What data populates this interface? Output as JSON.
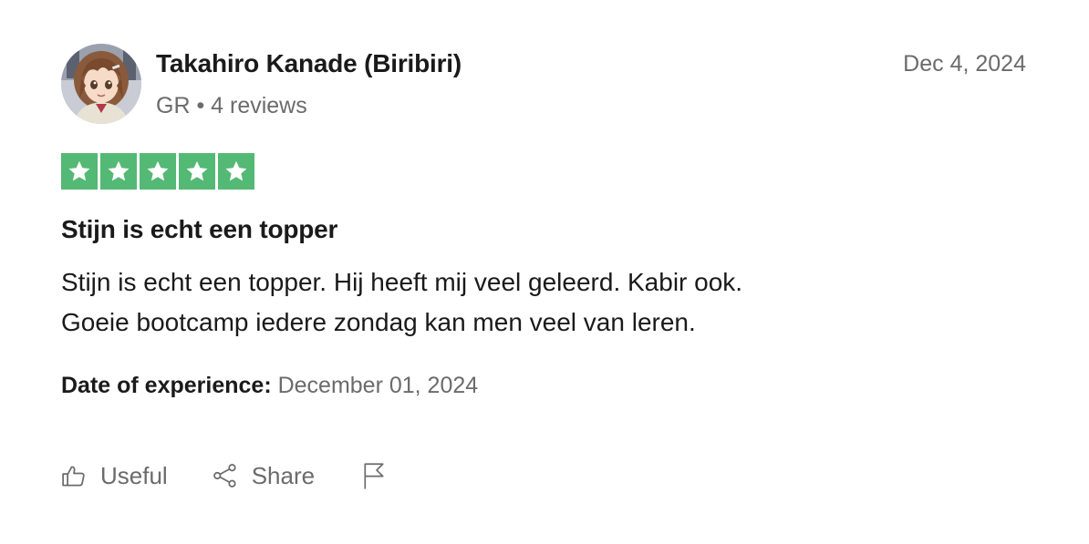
{
  "reviewer": {
    "name": "Takahiro Kanade (Biribiri)",
    "meta": "GR • 4 reviews",
    "avatar_icon": "anime-girl-avatar"
  },
  "review": {
    "date": "Dec 4, 2024",
    "rating": 5,
    "rating_max": 5,
    "star_color": "#54b974",
    "title": "Stijn is echt een topper",
    "body_lines": [
      "Stijn is echt een topper. Hij heeft mij veel geleerd. Kabir ook.",
      "Goeie bootcamp iedere zondag kan men veel van leren."
    ],
    "experience_label": "Date of experience:",
    "experience_date": "December 01, 2024"
  },
  "actions": {
    "useful_label": "Useful",
    "useful_icon": "thumbs-up-icon",
    "share_label": "Share",
    "share_icon": "share-icon",
    "flag_icon": "flag-icon"
  }
}
